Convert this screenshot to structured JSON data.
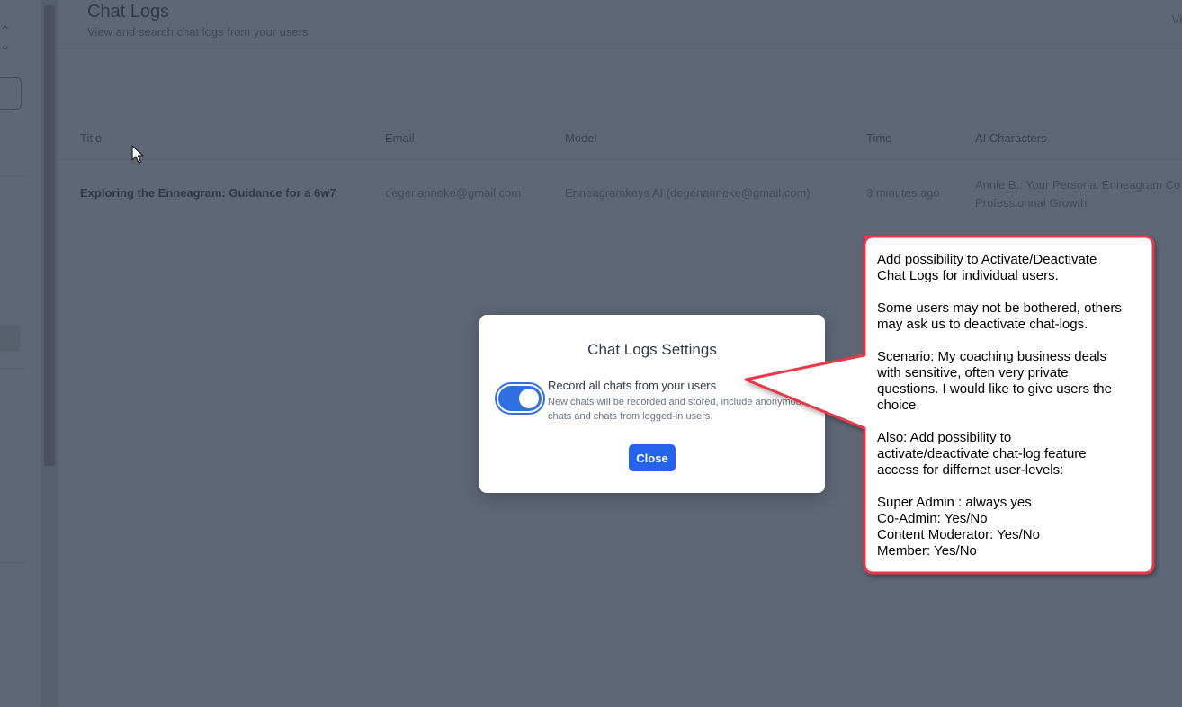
{
  "header": {
    "title": "Chat Logs",
    "subtitle": "View and search chat logs from your users",
    "view_link": "Vi"
  },
  "table": {
    "columns": [
      "Title",
      "Email",
      "Model",
      "Time",
      "AI Characters"
    ],
    "rows": [
      {
        "title": "Exploring the Enneagram: Guidance for a 6w7",
        "email": "degenanneke@gmail.com",
        "model": "Enneagramkeys AI (degenanneke@gmail.com)",
        "time": "3 minutes ago",
        "ai_characters_line1": "Annie B.: Your Personal Enneagram Co",
        "ai_characters_line2": "Professionnal Growth"
      }
    ]
  },
  "modal": {
    "title": "Chat Logs Settings",
    "toggle_on": true,
    "option_label": "Record all chats from your users",
    "option_description": "New chats will be recorded and stored, include anonymous chats and chats from logged-in users.",
    "close_label": "Close"
  },
  "annotation": {
    "p1": [
      "Add possibility to Activate/Deactivate",
      "Chat Logs for individual users."
    ],
    "p2": [
      "Some users may not be bothered, others",
      "may ask us to deactivate chat-logs."
    ],
    "p3": [
      "Scenario: My coaching business deals",
      "with sensitive, often very private",
      "questions. I would like to give users the",
      "choice."
    ],
    "p4": [
      "Also: Add possibility to",
      "activate/deactivate chat-log feature",
      "access for differnet user-levels:"
    ],
    "p5": [
      "Super Admin : always yes",
      "Co-Admin: Yes/No",
      "Content Moderator: Yes/No",
      "Member: Yes/No"
    ]
  },
  "colors": {
    "accent": "#2563eb",
    "callout_border": "#e8394a",
    "overlay": "#5f6776"
  }
}
